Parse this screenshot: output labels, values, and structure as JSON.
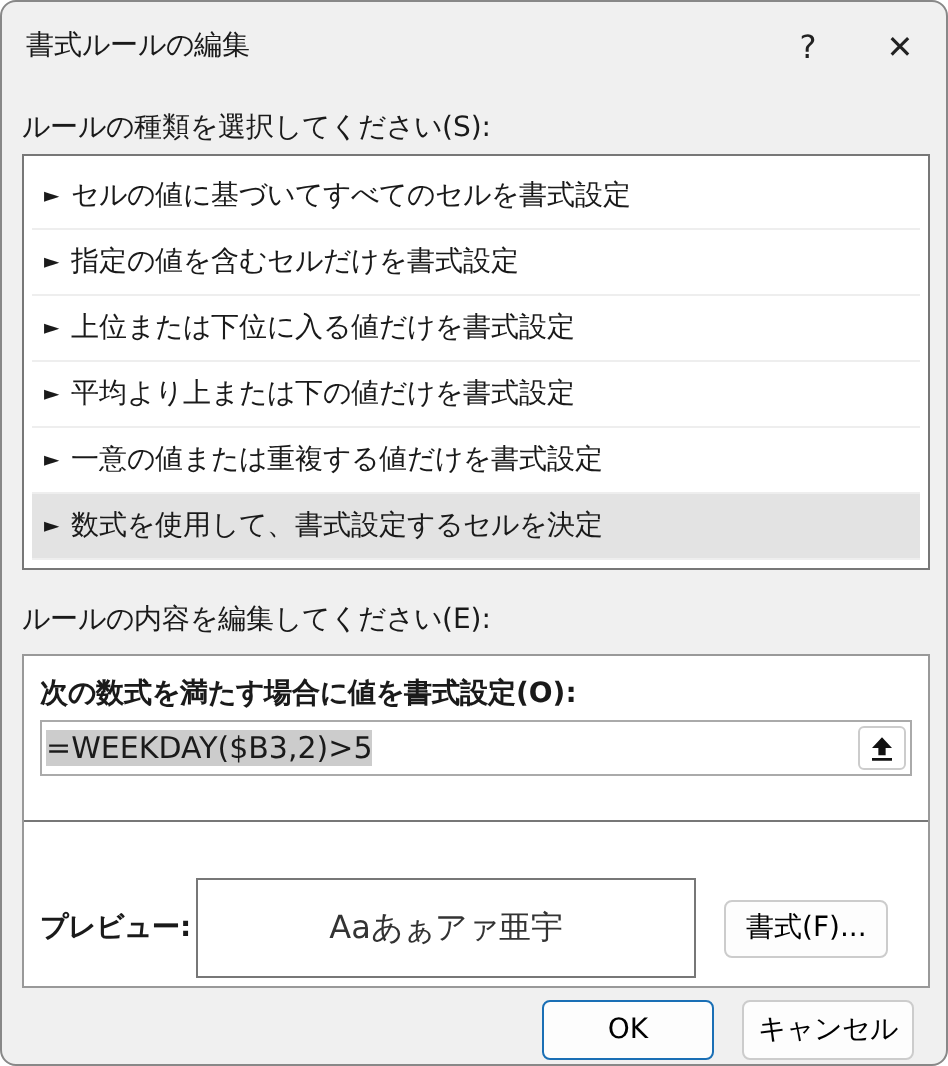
{
  "window": {
    "title": "書式ルールの編集",
    "help": "?",
    "close": "✕"
  },
  "rule_type": {
    "label": "ルールの種類を選択してください(S):",
    "items": [
      {
        "marker": "►",
        "label": "セルの値に基づいてすべてのセルを書式設定",
        "selected": false
      },
      {
        "marker": "►",
        "label": "指定の値を含むセルだけを書式設定",
        "selected": false
      },
      {
        "marker": "►",
        "label": "上位または下位に入る値だけを書式設定",
        "selected": false
      },
      {
        "marker": "►",
        "label": "平均より上または下の値だけを書式設定",
        "selected": false
      },
      {
        "marker": "►",
        "label": "一意の値または重複する値だけを書式設定",
        "selected": false
      },
      {
        "marker": "►",
        "label": "数式を使用して、書式設定するセルを決定",
        "selected": true
      }
    ]
  },
  "rule_content": {
    "label": "ルールの内容を編集してください(E):",
    "formula_label": "次の数式を満たす場合に値を書式設定(O):",
    "formula": {
      "value": "=WEEKDAY($B3,2)>5",
      "text_selected": true
    },
    "preview_label": "プレビュー:",
    "preview_sample": "Aaあぁアァ亜宇",
    "format_button": "書式(F)..."
  },
  "buttons": [
    {
      "label": "OK",
      "default": true
    },
    {
      "label": "キャンセル",
      "default": false
    }
  ]
}
